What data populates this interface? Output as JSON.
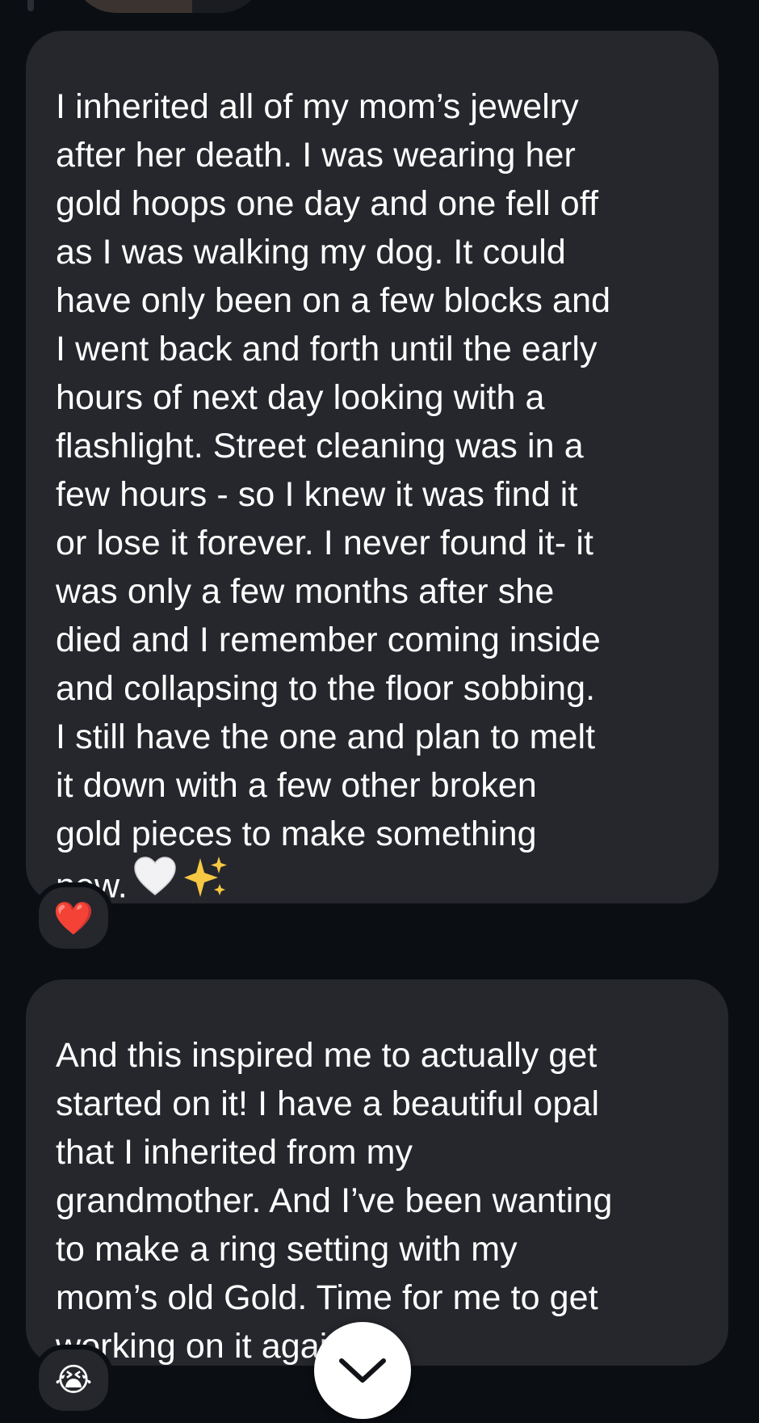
{
  "messages": [
    {
      "lines": [
        "I inherited all of my mom’s jewelry",
        "after her death. I was wearing her",
        "gold hoops one day and one fell off",
        "as I was walking my dog. It could",
        "have only been on a few blocks and",
        "I went back and forth until the early",
        "hours of next day looking with a",
        "flashlight. Street cleaning was in a",
        "few hours - so I knew it was find it",
        "or lose it forever. I never found it- it",
        "was only a few months after she",
        "died and I remember coming inside",
        "and collapsing to the floor sobbing.",
        "I still have the one and plan to melt",
        "it down with a few other broken",
        "gold pieces to make something",
        "new."
      ],
      "trailing_emoji": [
        "white-heart-icon",
        "sparkles-icon"
      ],
      "reaction": "❤️"
    },
    {
      "lines": [
        "And this inspired me to actually get",
        "started on it! I have a beautiful opal",
        "that I inherited from my",
        "grandmother. And I’ve been wanting",
        "to make a ring setting with my",
        "mom’s old Gold. Time for me to get",
        "working on it again!"
      ],
      "reaction": "😭"
    }
  ],
  "colors": {
    "background": "#0b0e13",
    "bubble": "#25272d",
    "text": "#ffffff",
    "scroll_button": "#ffffff"
  },
  "icons": {
    "scroll_down": "chevron-down-icon"
  }
}
